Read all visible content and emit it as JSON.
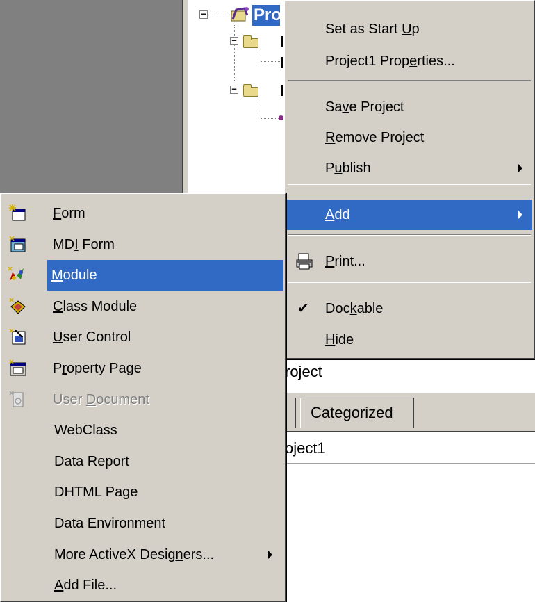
{
  "tree": {
    "root_label": "Pro"
  },
  "context_menu": {
    "items": [
      {
        "label": "Set as Start Up",
        "ul": 13
      },
      {
        "label": "Project1 Properties...",
        "ul": 13
      },
      {
        "label": "Save Project",
        "ul": 2
      },
      {
        "label": "Remove Project",
        "ul": 0
      },
      {
        "label": "Publish",
        "ul": 1,
        "submenu": true
      },
      {
        "label": "Add",
        "ul": 0,
        "submenu": true,
        "highlighted": true
      },
      {
        "label": "Print...",
        "ul": 0,
        "icon": "printer-icon"
      },
      {
        "label": "Dockable",
        "ul": 3,
        "checked": true
      },
      {
        "label": "Hide",
        "ul": 0
      }
    ]
  },
  "add_menu": {
    "items": [
      {
        "label": "Form",
        "ul": 0,
        "icon": "form-icon"
      },
      {
        "label": "MDI Form",
        "ul": 2,
        "icon": "mdi-form-icon"
      },
      {
        "label": "Module",
        "ul": 0,
        "icon": "module-icon",
        "highlighted": true
      },
      {
        "label": "Class Module",
        "ul": 0,
        "icon": "class-module-icon"
      },
      {
        "label": "User Control",
        "ul": 0,
        "icon": "user-control-icon"
      },
      {
        "label": "Property Page",
        "ul": 1,
        "icon": "property-page-icon"
      },
      {
        "label": "User Document",
        "ul": 5,
        "icon": "user-document-icon",
        "disabled": true
      },
      {
        "label": "WebClass",
        "ul": -1
      },
      {
        "label": "Data Report",
        "ul": -1
      },
      {
        "label": "DHTML Page",
        "ul": -1
      },
      {
        "label": "Data Environment",
        "ul": -1
      },
      {
        "label": "More ActiveX Designers...",
        "ul": 18,
        "submenu": true
      },
      {
        "label": "Add File...",
        "ul": 0
      }
    ]
  },
  "properties": {
    "object_text": "roject",
    "tab_label": "Categorized",
    "value_text": "oject1"
  },
  "colors": {
    "highlight": "#316ac5",
    "menu_bg": "#d4d0c8"
  }
}
